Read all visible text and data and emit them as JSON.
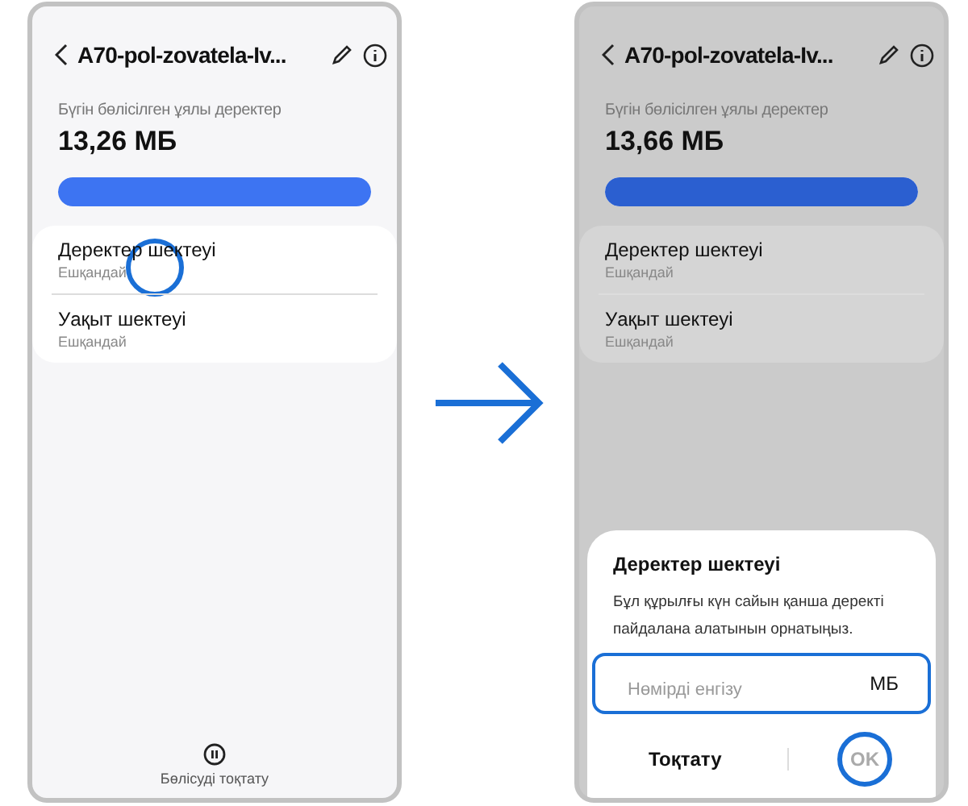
{
  "screens": [
    {
      "dimmed": false,
      "title": "A70-pol-zovatela-Iv...",
      "usage_label": "Бүгін бөлісілген ұялы деректер",
      "usage_value": "13,26 МБ",
      "level": 1,
      "limits": [
        {
          "title": "Деректер шектеуі",
          "value": "Ешқандай",
          "highlighted": true
        },
        {
          "title": "Уақыт шектеуі",
          "value": "Ешқандай",
          "highlighted": false
        }
      ],
      "footer": "Бөлісуді тоқтату"
    },
    {
      "dimmed": true,
      "title": "A70-pol-zovatela-Iv...",
      "usage_label": "Бүгін бөлісілген ұялы деректер",
      "usage_value": "13,66 МБ",
      "level": 1,
      "limits": [
        {
          "title": "Деректер шектеуі",
          "value": "Ешқандай",
          "highlighted": false
        },
        {
          "title": "Уақыт шектеуі",
          "value": "Ешқандай",
          "highlighted": false
        }
      ],
      "dialog": {
        "title": "Деректер шектеуі",
        "text": "Бұл құрылғы күн сайын қанша деректі пайдалана алатынын орнатыңыз.",
        "placeholder": "Нөмірді енгізу",
        "unit": "МБ",
        "field_highlighted": true,
        "buttons": [
          {
            "label": "Тоқтату",
            "disabled": false,
            "highlighted": false
          },
          {
            "label": "OK",
            "disabled": true,
            "highlighted": true
          }
        ]
      }
    }
  ]
}
